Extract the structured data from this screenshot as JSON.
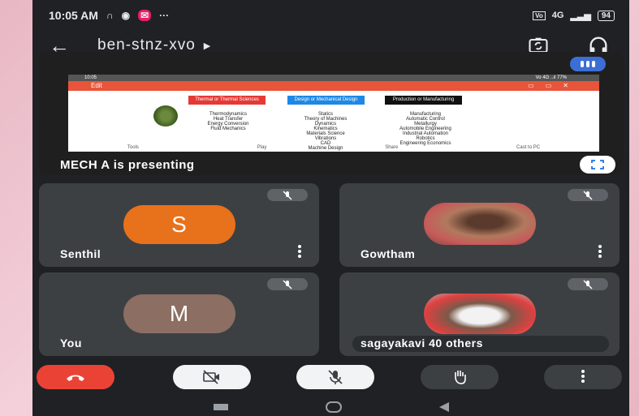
{
  "status_bar": {
    "time": "10:05 AM",
    "network": "4G",
    "battery": "94"
  },
  "top_bar": {
    "meeting_code": "ben-stnz-xvo"
  },
  "presentation": {
    "label": "MECH A is presenting",
    "shared_screen": {
      "status_time": "10:05",
      "status_right": "Vo 4G ..ıl 77%",
      "toolbar_title": "Edit",
      "boxes": [
        {
          "text": "Thermal or Thermal Sciences",
          "color": "#e53935"
        },
        {
          "text": "Design or Mechanical Design",
          "color": "#1e88e5"
        },
        {
          "text": "Production or Manufacturing",
          "color": "#111111"
        }
      ],
      "lists": [
        [
          "Thermodynamics",
          "Heat Transfer",
          "Energy Conversion",
          "Fluid Mechanics"
        ],
        [
          "Statics",
          "Theory of Machines",
          "Dynamics",
          "Kinematics",
          "Materials Science",
          "Vibrations",
          "CAD",
          "Machine Design"
        ],
        [
          "Manufacturing",
          "Automatic Control",
          "Metallurgy",
          "Automobile Engineering",
          "Industrial Automation",
          "Robotics",
          "Engineering Economics"
        ]
      ],
      "bottom_tabs": [
        "Tools",
        "Play",
        "Share",
        "Cast to PC"
      ]
    }
  },
  "participants": [
    {
      "name": "Senthil",
      "initial": "S",
      "avatar_color": "#e8711c",
      "type": "initial"
    },
    {
      "name": "Gowtham",
      "type": "photo"
    },
    {
      "name": "You",
      "initial": "M",
      "avatar_color": "#8d6e63",
      "type": "initial"
    },
    {
      "name": "sagayakavi 40 others",
      "type": "photo"
    }
  ],
  "controls": {
    "end_call_color": "#ea4335"
  }
}
